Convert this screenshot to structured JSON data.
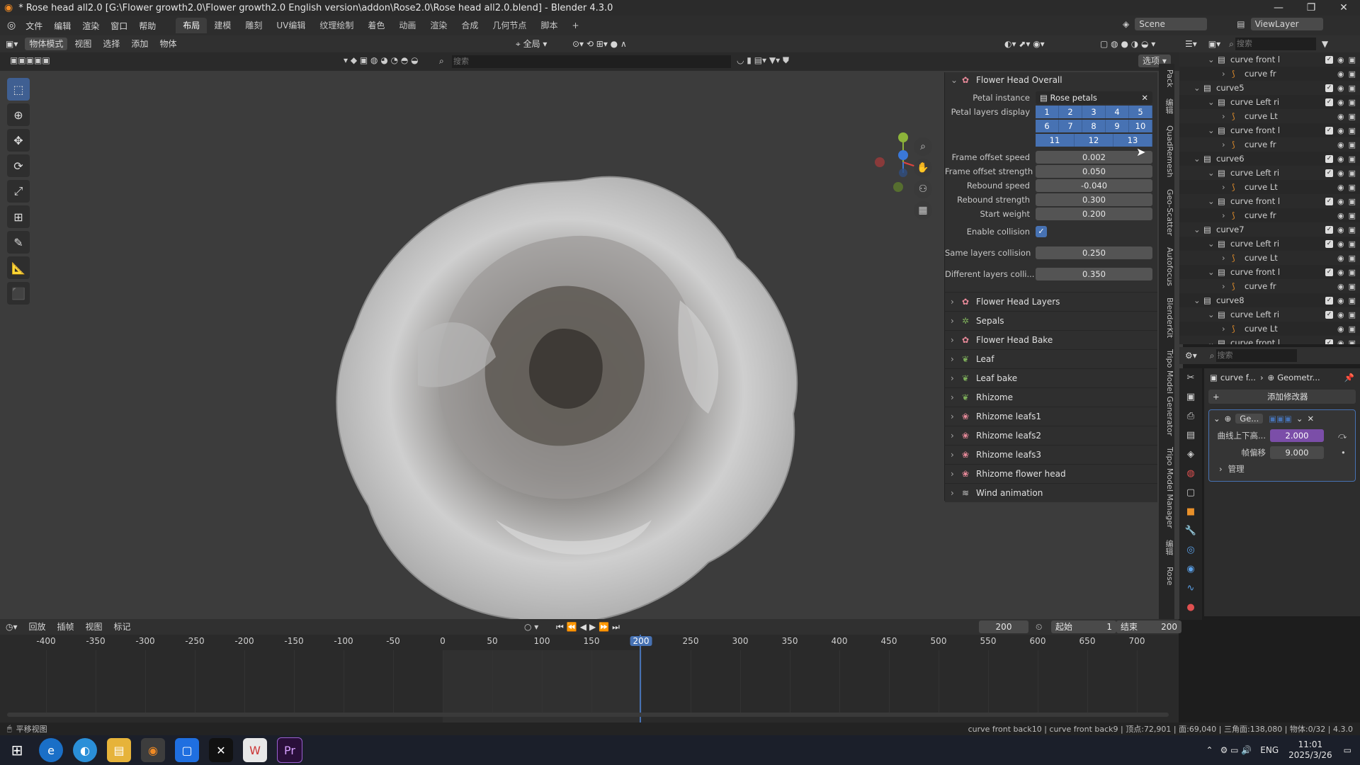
{
  "window": {
    "title": "* Rose head all2.0 [G:\\Flower growth2.0\\Flower growth2.0 English version\\addon\\Rose2.0\\Rose head all2.0.blend] - Blender 4.3.0",
    "min": "—",
    "max": "❐",
    "close": "✕"
  },
  "menu": [
    "文件",
    "编辑",
    "渲染",
    "窗口",
    "帮助"
  ],
  "workspaces": [
    "布局",
    "建模",
    "雕刻",
    "UV编辑",
    "纹理绘制",
    "着色",
    "动画",
    "渲染",
    "合成",
    "几何节点",
    "脚本"
  ],
  "add_workspace": "+",
  "scene": {
    "label": "Scene",
    "viewlayer": "ViewLayer"
  },
  "viewport_header": {
    "mode": "物体模式",
    "items": [
      "视图",
      "选择",
      "添加",
      "物体"
    ],
    "transform": "全局",
    "search_placeholder": "搜索",
    "options": "选项"
  },
  "n_panel": {
    "title": "Flower Head Overall",
    "petal_instance_label": "Petal instance",
    "petal_instance_value": "Rose petals",
    "petal_layers_label": "Petal layers display",
    "layers_row1": [
      "1",
      "2",
      "3",
      "4",
      "5"
    ],
    "layers_row2": [
      "6",
      "7",
      "8",
      "9",
      "10"
    ],
    "layers_row3": [
      "11",
      "12",
      "13"
    ],
    "props": [
      {
        "label": "Frame offset speed",
        "value": "0.002"
      },
      {
        "label": "Frame offset strength",
        "value": "0.050"
      },
      {
        "label": "Rebound speed",
        "value": "-0.040"
      },
      {
        "label": "Rebound strength",
        "value": "0.300"
      },
      {
        "label": "Start weight",
        "value": "0.200"
      }
    ],
    "enable_collision_label": "Enable collision",
    "same_layers_label": "Same layers collision",
    "same_layers_value": "0.250",
    "different_layers_label": "Different layers colli...",
    "different_layers_value": "0.350",
    "sub_panels": [
      "Flower Head Layers",
      "Sepals",
      "Flower Head Bake",
      "Leaf",
      "Leaf bake",
      "Rhizome",
      "Rhizome leafs1",
      "Rhizome leafs2",
      "Rhizome leafs3",
      "Rhizome flower head",
      "Wind animation"
    ]
  },
  "side_tabs": [
    "Pack",
    "编辑",
    "QuadRemesh",
    "Geo-Scatter",
    "Autofocus",
    "BlenderKit",
    "Tripo Model Generator",
    "Tripo Model Manager",
    "编辑",
    "Rose"
  ],
  "outliner": {
    "search_placeholder": "搜索",
    "rows": [
      {
        "indent": 3,
        "name": "curve front l",
        "type": "collection"
      },
      {
        "indent": 4,
        "name": "curve fr",
        "type": "curve"
      },
      {
        "indent": 2,
        "name": "curve5",
        "type": "collection"
      },
      {
        "indent": 3,
        "name": "curve Left ri",
        "type": "collection"
      },
      {
        "indent": 4,
        "name": "curve Lt",
        "type": "curve"
      },
      {
        "indent": 3,
        "name": "curve front l",
        "type": "collection"
      },
      {
        "indent": 4,
        "name": "curve fr",
        "type": "curve"
      },
      {
        "indent": 2,
        "name": "curve6",
        "type": "collection"
      },
      {
        "indent": 3,
        "name": "curve Left ri",
        "type": "collection"
      },
      {
        "indent": 4,
        "name": "curve Lt",
        "type": "curve"
      },
      {
        "indent": 3,
        "name": "curve front l",
        "type": "collection"
      },
      {
        "indent": 4,
        "name": "curve fr",
        "type": "curve"
      },
      {
        "indent": 2,
        "name": "curve7",
        "type": "collection"
      },
      {
        "indent": 3,
        "name": "curve Left ri",
        "type": "collection"
      },
      {
        "indent": 4,
        "name": "curve Lt",
        "type": "curve"
      },
      {
        "indent": 3,
        "name": "curve front l",
        "type": "collection"
      },
      {
        "indent": 4,
        "name": "curve fr",
        "type": "curve"
      },
      {
        "indent": 2,
        "name": "curve8",
        "type": "collection"
      },
      {
        "indent": 3,
        "name": "curve Left ri",
        "type": "collection"
      },
      {
        "indent": 4,
        "name": "curve Lt",
        "type": "curve"
      },
      {
        "indent": 3,
        "name": "curve front l",
        "type": "collection"
      }
    ]
  },
  "properties": {
    "search_placeholder": "搜索",
    "breadcrumb_object": "curve f...",
    "breadcrumb_modifier": "Geometr...",
    "add_modifier": "添加修改器",
    "modifier_name": "Ge...",
    "fields": [
      {
        "label": "曲线上下高...",
        "value": "2.000",
        "highlight": true
      },
      {
        "label": "帧偏移",
        "value": "9.000",
        "highlight": false
      }
    ],
    "manage": "管理"
  },
  "timeline": {
    "menus": [
      "回放",
      "插帧",
      "视图",
      "标记"
    ],
    "current_frame": "200",
    "start_label": "起始",
    "start": "1",
    "end_label": "结束",
    "end": "200",
    "ticks": [
      "-400",
      "-350",
      "-300",
      "-250",
      "-200",
      "-150",
      "-100",
      "-50",
      "0",
      "50",
      "100",
      "150",
      "200",
      "250",
      "300",
      "350",
      "400",
      "450",
      "500",
      "550",
      "600",
      "650",
      "700"
    ]
  },
  "status": {
    "left": "平移视图",
    "right": "curve front back10 | curve front back9 | 顶点:72,901 | 面:69,040 | 三角面:138,080 | 物体:0/32 | 4.3.0"
  },
  "taskbar": {
    "lang": "ENG",
    "time": "11:01",
    "date": "2025/3/26"
  },
  "colors": {
    "accent": "#4772b3",
    "highlight_field": "#7b4ea8",
    "frame_marker": "#4772b3"
  }
}
